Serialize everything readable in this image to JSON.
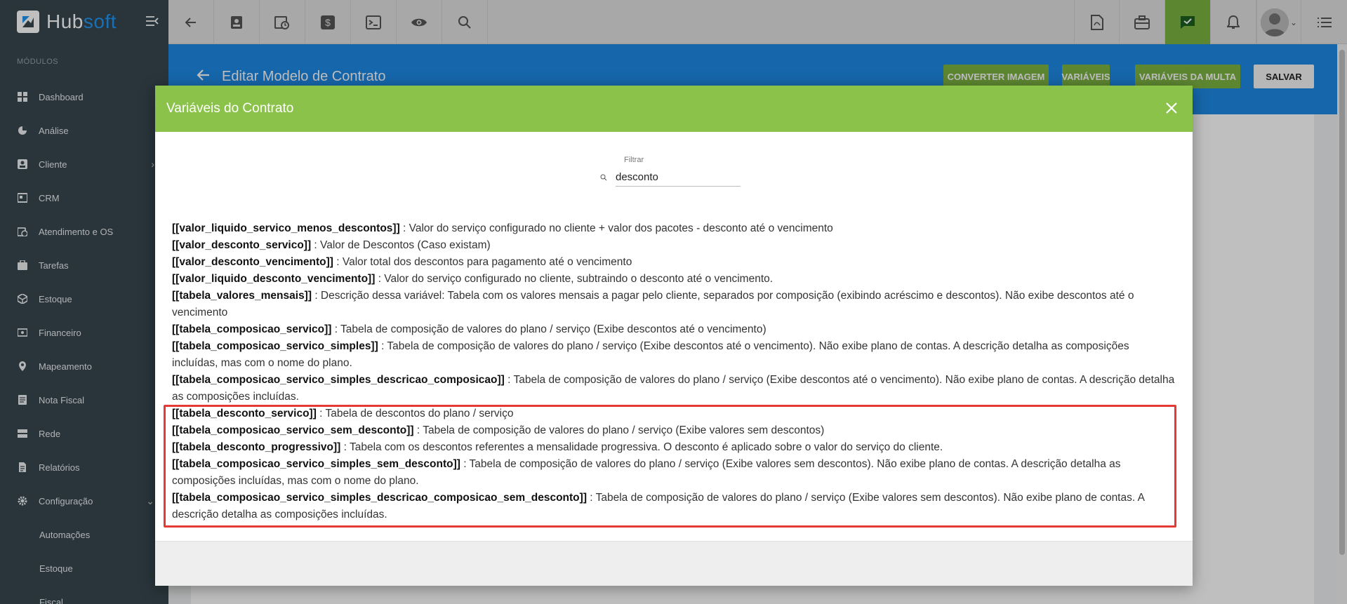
{
  "app": {
    "name_part1": "Hub",
    "name_part2": "soft"
  },
  "sidebar": {
    "section_label": "MÓDULOS",
    "items": [
      {
        "label": "Dashboard",
        "icon": "dashboard-icon"
      },
      {
        "label": "Análise",
        "icon": "pie-chart-icon"
      },
      {
        "label": "Cliente",
        "icon": "person-card-icon"
      },
      {
        "label": "CRM",
        "icon": "crm-icon"
      },
      {
        "label": "Atendimento e OS",
        "icon": "calendar-clock-icon"
      },
      {
        "label": "Tarefas",
        "icon": "tasks-icon"
      },
      {
        "label": "Estoque",
        "icon": "box-icon"
      },
      {
        "label": "Financeiro",
        "icon": "money-icon"
      },
      {
        "label": "Mapeamento",
        "icon": "map-pin-icon"
      },
      {
        "label": "Nota Fiscal",
        "icon": "invoice-icon"
      },
      {
        "label": "Rede",
        "icon": "network-icon"
      },
      {
        "label": "Relatórios",
        "icon": "report-icon"
      },
      {
        "label": "Configuração",
        "icon": "gear-icon"
      }
    ],
    "sub_items": [
      "Automações",
      "Estoque",
      "Fiscal"
    ]
  },
  "header": {
    "title": "Editar Modelo de Contrato",
    "buttons": {
      "convert_image": "CONVERTER IMAGEM",
      "variables": "VARIÁVEIS",
      "fine_variables": "VARIÁVEIS DA MULTA",
      "save": "SALVAR"
    }
  },
  "modal": {
    "title": "Variáveis do Contrato",
    "filter": {
      "label": "Filtrar",
      "value": "desconto"
    },
    "variables": [
      {
        "name": "[[valor_liquido_servico_menos_descontos]]",
        "desc": " : Valor do serviço configurado no cliente + valor dos pacotes - desconto até o vencimento"
      },
      {
        "name": "[[valor_desconto_servico]]",
        "desc": " : Valor de Descontos (Caso existam)"
      },
      {
        "name": "[[valor_desconto_vencimento]]",
        "desc": " : Valor total dos descontos para pagamento até o vencimento"
      },
      {
        "name": "[[valor_liquido_desconto_vencimento]]",
        "desc": " : Valor do serviço configurado no cliente, subtraindo o desconto até o vencimento."
      },
      {
        "name": "[[tabela_valores_mensais]]",
        "desc": " : Descrição dessa variável: Tabela com os valores mensais a pagar pelo cliente, separados por composição (exibindo acréscimo e descontos). Não exibe descontos até o vencimento"
      },
      {
        "name": "[[tabela_composicao_servico]]",
        "desc": " : Tabela de composição de valores do plano / serviço (Exibe descontos até o vencimento)"
      },
      {
        "name": "[[tabela_composicao_servico_simples]]",
        "desc": " : Tabela de composição de valores do plano / serviço (Exibe descontos até o vencimento). Não exibe plano de contas. A descrição detalha as composições incluídas, mas com o nome do plano."
      },
      {
        "name": "[[tabela_composicao_servico_simples_descricao_composicao]]",
        "desc": " : Tabela de composição de valores do plano / serviço (Exibe descontos até o vencimento). Não exibe plano de contas. A descrição detalha as composições incluídas."
      },
      {
        "name": "[[tabela_desconto_servico]]",
        "desc": " : Tabela de descontos do plano / serviço"
      },
      {
        "name": "[[tabela_composicao_servico_sem_desconto]]",
        "desc": " : Tabela de composição de valores do plano / serviço (Exibe valores sem descontos)"
      },
      {
        "name": "[[tabela_desconto_progressivo]]",
        "desc": " : Tabela com os descontos referentes a mensalidade progressiva. O desconto é aplicado sobre o valor do serviço do cliente."
      },
      {
        "name": "[[tabela_composicao_servico_simples_sem_desconto]]",
        "desc": " : Tabela de composição de valores do plano / serviço (Exibe valores sem descontos). Não exibe plano de contas. A descrição detalha as composições incluídas, mas com o nome do plano."
      },
      {
        "name": "[[tabela_composicao_servico_simples_descricao_composicao_sem_desconto]]",
        "desc": " : Tabela de composição de valores do plano / serviço (Exibe valores sem descontos). Não exibe plano de contas. A descrição detalha as composições incluídas."
      }
    ]
  },
  "colors": {
    "header_blue": "#1e88e5",
    "modal_green": "#8bc34a",
    "button_green": "#7cb342",
    "sidebar": "#37474f",
    "highlight_red": "#e53935"
  }
}
